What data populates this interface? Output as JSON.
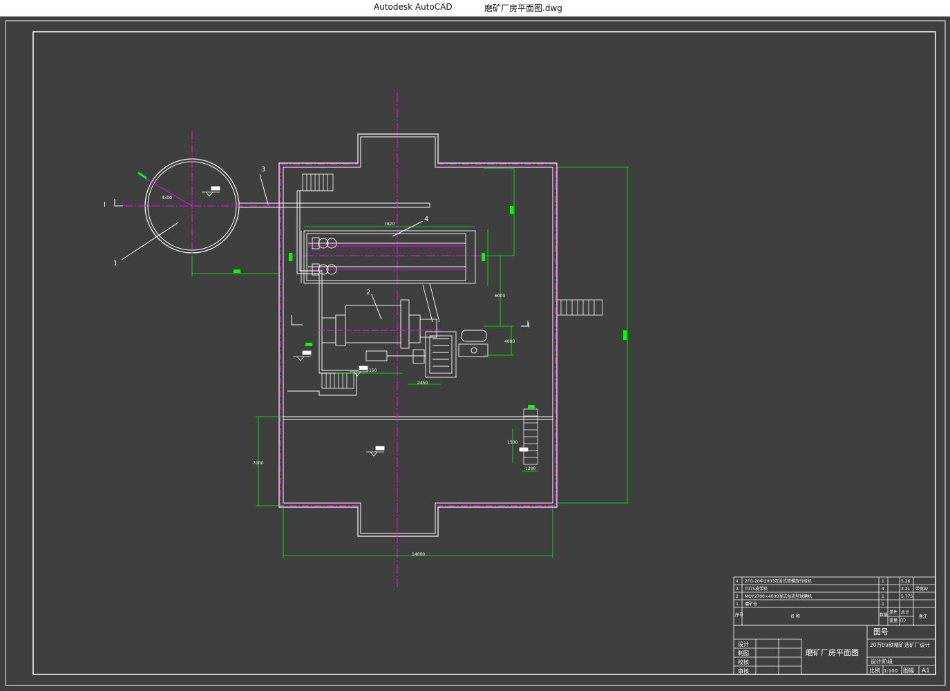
{
  "window": {
    "app_name": "Autodesk AutoCAD",
    "document_name": "磨矿厂房平面图.dwg"
  },
  "drawing": {
    "callouts": [
      "1",
      "2",
      "3",
      "4"
    ],
    "section_marks": [
      "I",
      "I"
    ],
    "dimensions": {
      "d_4x00": "4x00",
      "d_1820": "1820",
      "d_6000": "6000",
      "d_4000": "4000",
      "d_5150": "5150",
      "d_2450": "2450",
      "d_7000": "7000",
      "d_1500": "1500",
      "d_1200": "1200",
      "d_14000": "14000"
    }
  },
  "parts_list": {
    "rows": [
      {
        "no": "4",
        "name": "2FG-20中2000沉没式双螺旋分级机",
        "qty": "1",
        "unit_weight": "",
        "total_weight": "5.26",
        "remark": ""
      },
      {
        "no": "3",
        "name": "T075皮带机",
        "qty": "4",
        "unit_weight": "",
        "total_weight": "3.21",
        "remark": "带宽B/"
      },
      {
        "no": "2",
        "name": "MQY2700×4000湿式溢流型球磨机",
        "qty": "1",
        "unit_weight": "",
        "total_weight": "5.775",
        "remark": ""
      },
      {
        "no": "1",
        "name": "磨矿仓",
        "qty": "1",
        "unit_weight": "",
        "total_weight": "",
        "remark": ""
      }
    ],
    "header": {
      "no": "序号",
      "name": "名          称",
      "qty": "数量",
      "unit_weight": "单件",
      "total_weight": "总计",
      "weight_unit": "重量（T）",
      "remark": "备注"
    }
  },
  "title_block": {
    "drawing_no_label": "图号",
    "roles": [
      "设计",
      "制图",
      "校核",
      "审核"
    ],
    "drawing_title": "磨矿厂房平面图",
    "project": "20万t/a铁精矿选矿厂设计",
    "stage_label": "设计阶段",
    "scale_label": "比例",
    "scale_value": "1:100",
    "sheet_label": "图幅",
    "sheet_value": "A1"
  },
  "colors": {
    "background": "#3f3f3f",
    "line_white": "#ffffff",
    "line_magenta": "#ff00ff",
    "line_green": "#00ff00",
    "titlebar": "#ffffff"
  }
}
